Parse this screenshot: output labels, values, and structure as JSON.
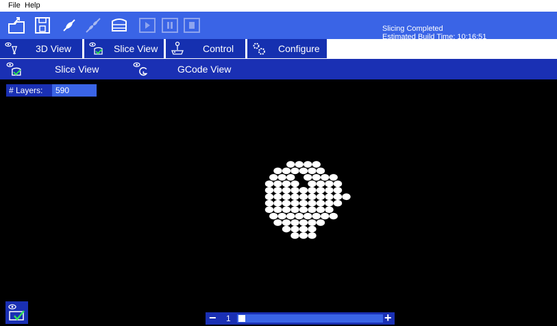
{
  "menu": {
    "file": "File",
    "help": "Help"
  },
  "toolbar": {
    "icons": [
      "open-file-icon",
      "save-icon",
      "connect-icon",
      "disconnect-icon",
      "slice-icon",
      "play-icon",
      "pause-icon",
      "stop-icon"
    ]
  },
  "status": {
    "line1": "Slicing Completed",
    "line2": "Estimated Build Time: 10:16:51"
  },
  "tabs": [
    {
      "label": "3D View",
      "icon": "view-3d-icon"
    },
    {
      "label": "Slice View",
      "icon": "slice-view-icon"
    },
    {
      "label": "Control",
      "icon": "joystick-icon"
    },
    {
      "label": "Configure",
      "icon": "gears-icon"
    }
  ],
  "subtabs": [
    {
      "label": "Slice View",
      "icon": "slice-view-icon"
    },
    {
      "label": "GCode View",
      "icon": "gcode-view-icon"
    }
  ],
  "layers": {
    "label": "# Layers:",
    "value": "590"
  },
  "layer_slider": {
    "minus": "−",
    "value": "1",
    "plus": "+",
    "fraction": 0.0
  },
  "colors": {
    "toolbar": "#3a64e6",
    "panel": "#1a30b4",
    "tab": "#1530b0",
    "background": "#000000"
  }
}
